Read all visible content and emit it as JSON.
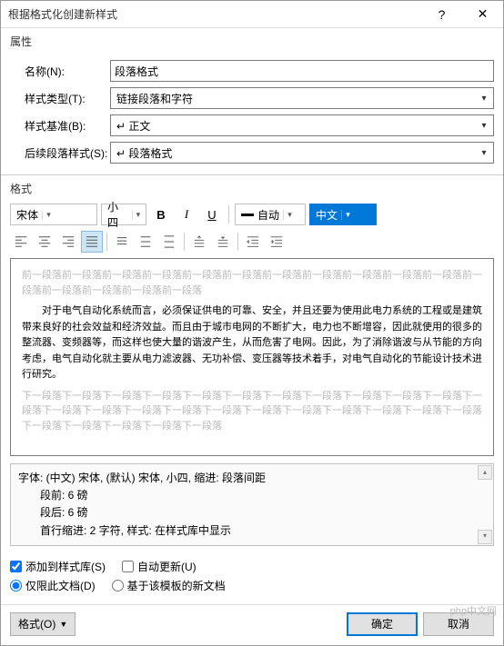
{
  "window": {
    "title": "根据格式化创建新样式"
  },
  "sections": {
    "attr": "属性",
    "format": "格式"
  },
  "form": {
    "name_label": "名称(N):",
    "name_value": "段落格式",
    "type_label": "样式类型(T):",
    "type_value": "链接段落和字符",
    "base_label": "样式基准(B):",
    "base_value": "↵ 正文",
    "next_label": "后续段落样式(S):",
    "next_value": "↵ 段落格式"
  },
  "toolbar": {
    "font": "宋体",
    "size": "小四",
    "auto": "自动",
    "lang": "中文"
  },
  "preview": {
    "before": "前一段落前一段落前一段落前一段落前一段落前一段落前一段落前一段落前一段落前一段落前一段落前一段落前一段落前一段落前一段落前一段落",
    "body": "对于电气自动化系统而言，必须保证供电的可靠、安全，并且还要为使用此电力系统的工程或是建筑带来良好的社会效益和经济效益。而且由于城市电网的不断扩大，电力也不断增容，因此就使用的很多的整流器、变频器等，而这样也使大量的谐波产生，从而危害了电网。因此，为了消除谐波与从节能的方向考虑，电气自动化就主要从电力滤波器、无功补偿、变压器等技术着手，对电气自动化的节能设计技术进行研究。",
    "after": "下一段落下一段落下一段落下一段落下一段落下一段落下一段落下一段落下一段落下一段落下一段落下一段落下一段落下一段落下一段落下一段落下一段落下一段落下一段落下一段落下一段落下一段落下一段落下一段落下一段落下一段落下一段落下一段落"
  },
  "desc": {
    "line1": "字体: (中文) 宋体, (默认) 宋体, 小四, 缩进: 段落间距",
    "line2": "段前: 6 磅",
    "line3": "段后: 6 磅",
    "line4": "首行缩进:  2 字符, 样式: 在样式库中显示"
  },
  "checks": {
    "add_lib": "添加到样式库(S)",
    "auto_update": "自动更新(U)",
    "this_doc": "仅限此文档(D)",
    "template": "基于该模板的新文档"
  },
  "footer": {
    "format_btn": "格式(O)",
    "ok": "确定",
    "cancel": "取消"
  },
  "watermark": "php中文网"
}
